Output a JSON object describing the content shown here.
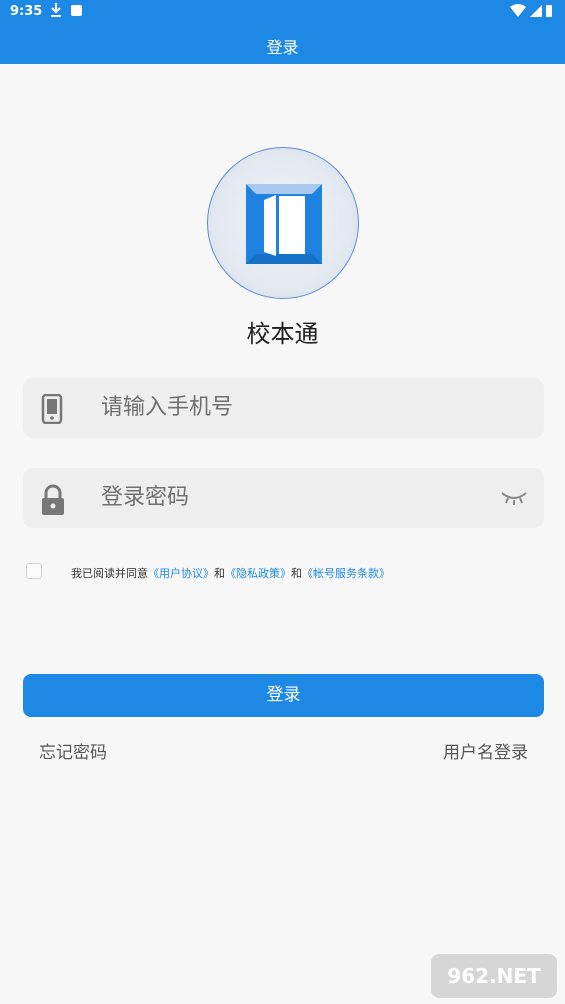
{
  "status": {
    "time": "9:35"
  },
  "appbar": {
    "title": "登录"
  },
  "app": {
    "name": "校本通"
  },
  "form": {
    "phone_placeholder": "请输入手机号",
    "password_placeholder": "登录密码"
  },
  "agreement": {
    "prefix": "我已阅读并同意",
    "user_agreement": "《用户协议》",
    "sep1": "和",
    "privacy_policy": "《隐私政策》",
    "sep2": "和",
    "account_terms": "《帐号服务条款》"
  },
  "actions": {
    "login_label": "登录",
    "forgot_password": "忘记密码",
    "username_login": "用户名登录"
  },
  "watermark": {
    "text": "962.NET"
  },
  "colors": {
    "primary": "#1e88e5",
    "background": "#f7f7f7",
    "field_bg": "#eeeeee"
  }
}
